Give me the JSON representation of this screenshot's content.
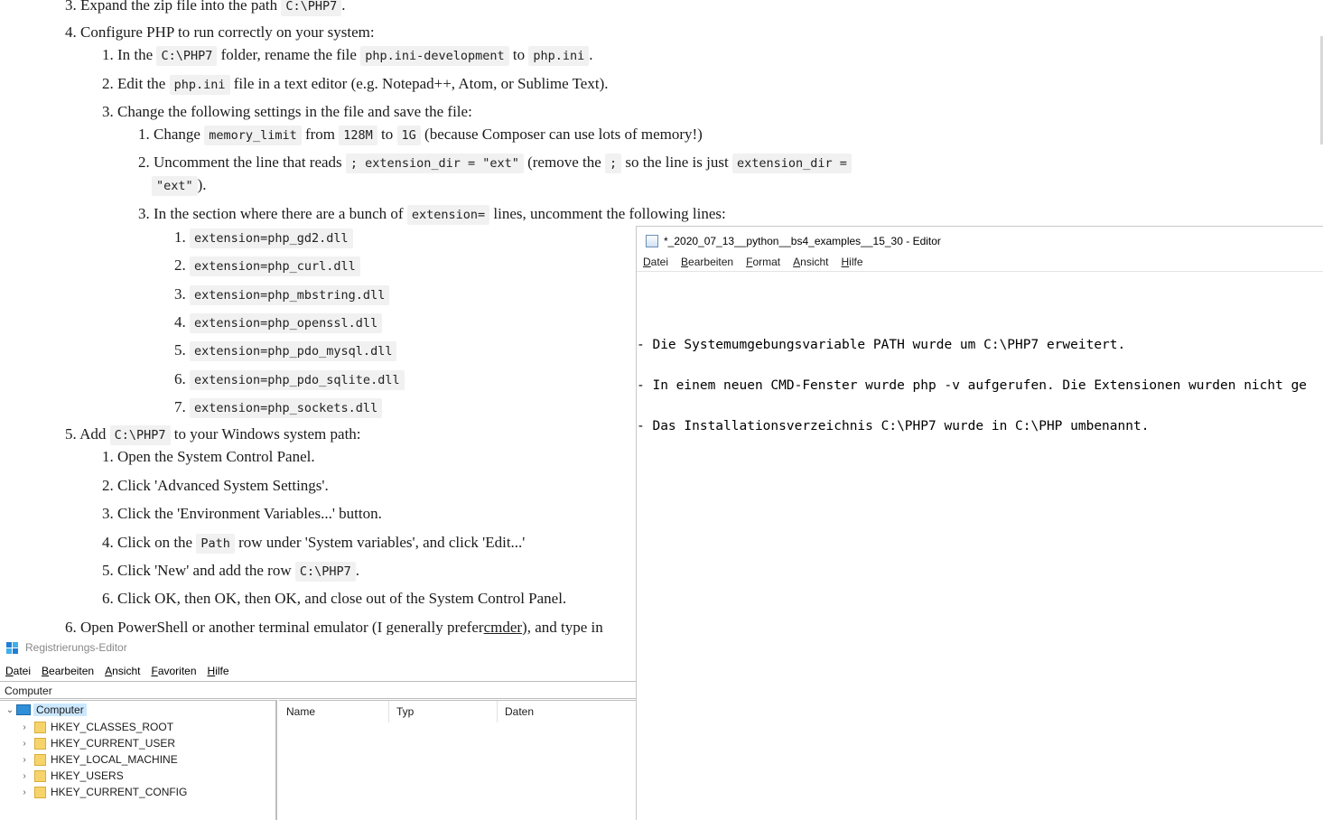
{
  "doc": {
    "l0": {
      "num": "3.",
      "pre": "Expand the zip file into the path",
      "c1": "C:\\PHP7",
      "post": "."
    },
    "l1": {
      "num": "4.",
      "text": "Configure PHP to run correctly on your system:"
    },
    "l2": {
      "num": "1.",
      "pre": "In the",
      "c1": "C:\\PHP7",
      "mid": "folder, rename the file",
      "c2": "php.ini-development",
      "mid2": "to",
      "c3": "php.ini",
      "post": "."
    },
    "l3": {
      "num": "2.",
      "pre": "Edit the",
      "c1": "php.ini",
      "post": "file in a text editor (e.g. Notepad++, Atom, or Sublime Text)."
    },
    "l4": {
      "num": "3.",
      "text": "Change the following settings in the file and save the file:"
    },
    "l5": {
      "num": "1.",
      "pre": "Change",
      "c1": "memory_limit",
      "mid": "from",
      "c2": "128M",
      "mid2": "to",
      "c3": "1G",
      "post": "(because Composer can use lots of memory!)"
    },
    "l6": {
      "num": "2.",
      "pre": "Uncomment the line that reads",
      "c1": "; extension_dir = \"ext\"",
      "mid": "(remove the",
      "c2": ";",
      "mid2": "so the line is just",
      "c3": "extension_dir ="
    },
    "l6b": {
      "c1": "\"ext\"",
      "post": ")."
    },
    "l7": {
      "num": "3.",
      "pre": "In the section where there are a bunch of",
      "c1": "extension=",
      "post": "lines, uncomment the following lines:"
    },
    "ext": [
      {
        "num": "1.",
        "code": "extension=php_gd2.dll"
      },
      {
        "num": "2.",
        "code": "extension=php_curl.dll"
      },
      {
        "num": "3.",
        "code": "extension=php_mbstring.dll"
      },
      {
        "num": "4.",
        "code": "extension=php_openssl.dll"
      },
      {
        "num": "5.",
        "code": "extension=php_pdo_mysql.dll"
      },
      {
        "num": "6.",
        "code": "extension=php_pdo_sqlite.dll"
      },
      {
        "num": "7.",
        "code": "extension=php_sockets.dll"
      }
    ],
    "l8": {
      "num": "5.",
      "pre": "Add",
      "c1": "C:\\PHP7",
      "post": "to your Windows system path:"
    },
    "steps": [
      {
        "num": "1.",
        "text": "Open the System Control Panel."
      },
      {
        "num": "2.",
        "text": "Click 'Advanced System Settings'."
      },
      {
        "num": "3.",
        "text": "Click the 'Environment Variables...' button."
      }
    ],
    "l9": {
      "num": "4.",
      "pre": "Click on the",
      "c1": "Path",
      "post": "row under 'System variables', and click 'Edit...'"
    },
    "l10": {
      "num": "5.",
      "pre": "Click 'New' and add the row",
      "c1": "C:\\PHP7",
      "post": "."
    },
    "l11": {
      "num": "6.",
      "text": "Click OK, then OK, then OK, and close out of the System Control Panel."
    },
    "l12": {
      "num": "6.",
      "pre": "Open PowerShell or another terminal emulator (I generally prefer",
      "link": "cmder",
      "post": "), and type in"
    }
  },
  "notepad": {
    "title": "*_2020_07_13__python__bs4_examples__15_30 - Editor",
    "menu": [
      "Datei",
      "Bearbeiten",
      "Format",
      "Ansicht",
      "Hilfe"
    ],
    "lines": [
      "- Die Systemumgebungsvariable PATH wurde um C:\\PHP7 erweitert.",
      "- In einem neuen CMD-Fenster wurde php -v aufgerufen. Die Extensionen wurden nicht ge",
      "- Das Installationsverzeichnis C:\\PHP7 wurde in C:\\PHP umbenannt."
    ]
  },
  "regedit": {
    "title": "Registrierungs-Editor",
    "menu": [
      "Datei",
      "Bearbeiten",
      "Ansicht",
      "Favoriten",
      "Hilfe"
    ],
    "address": "Computer",
    "root": "Computer",
    "keys": [
      "HKEY_CLASSES_ROOT",
      "HKEY_CURRENT_USER",
      "HKEY_LOCAL_MACHINE",
      "HKEY_USERS",
      "HKEY_CURRENT_CONFIG"
    ],
    "columns": [
      "Name",
      "Typ",
      "Daten"
    ]
  }
}
